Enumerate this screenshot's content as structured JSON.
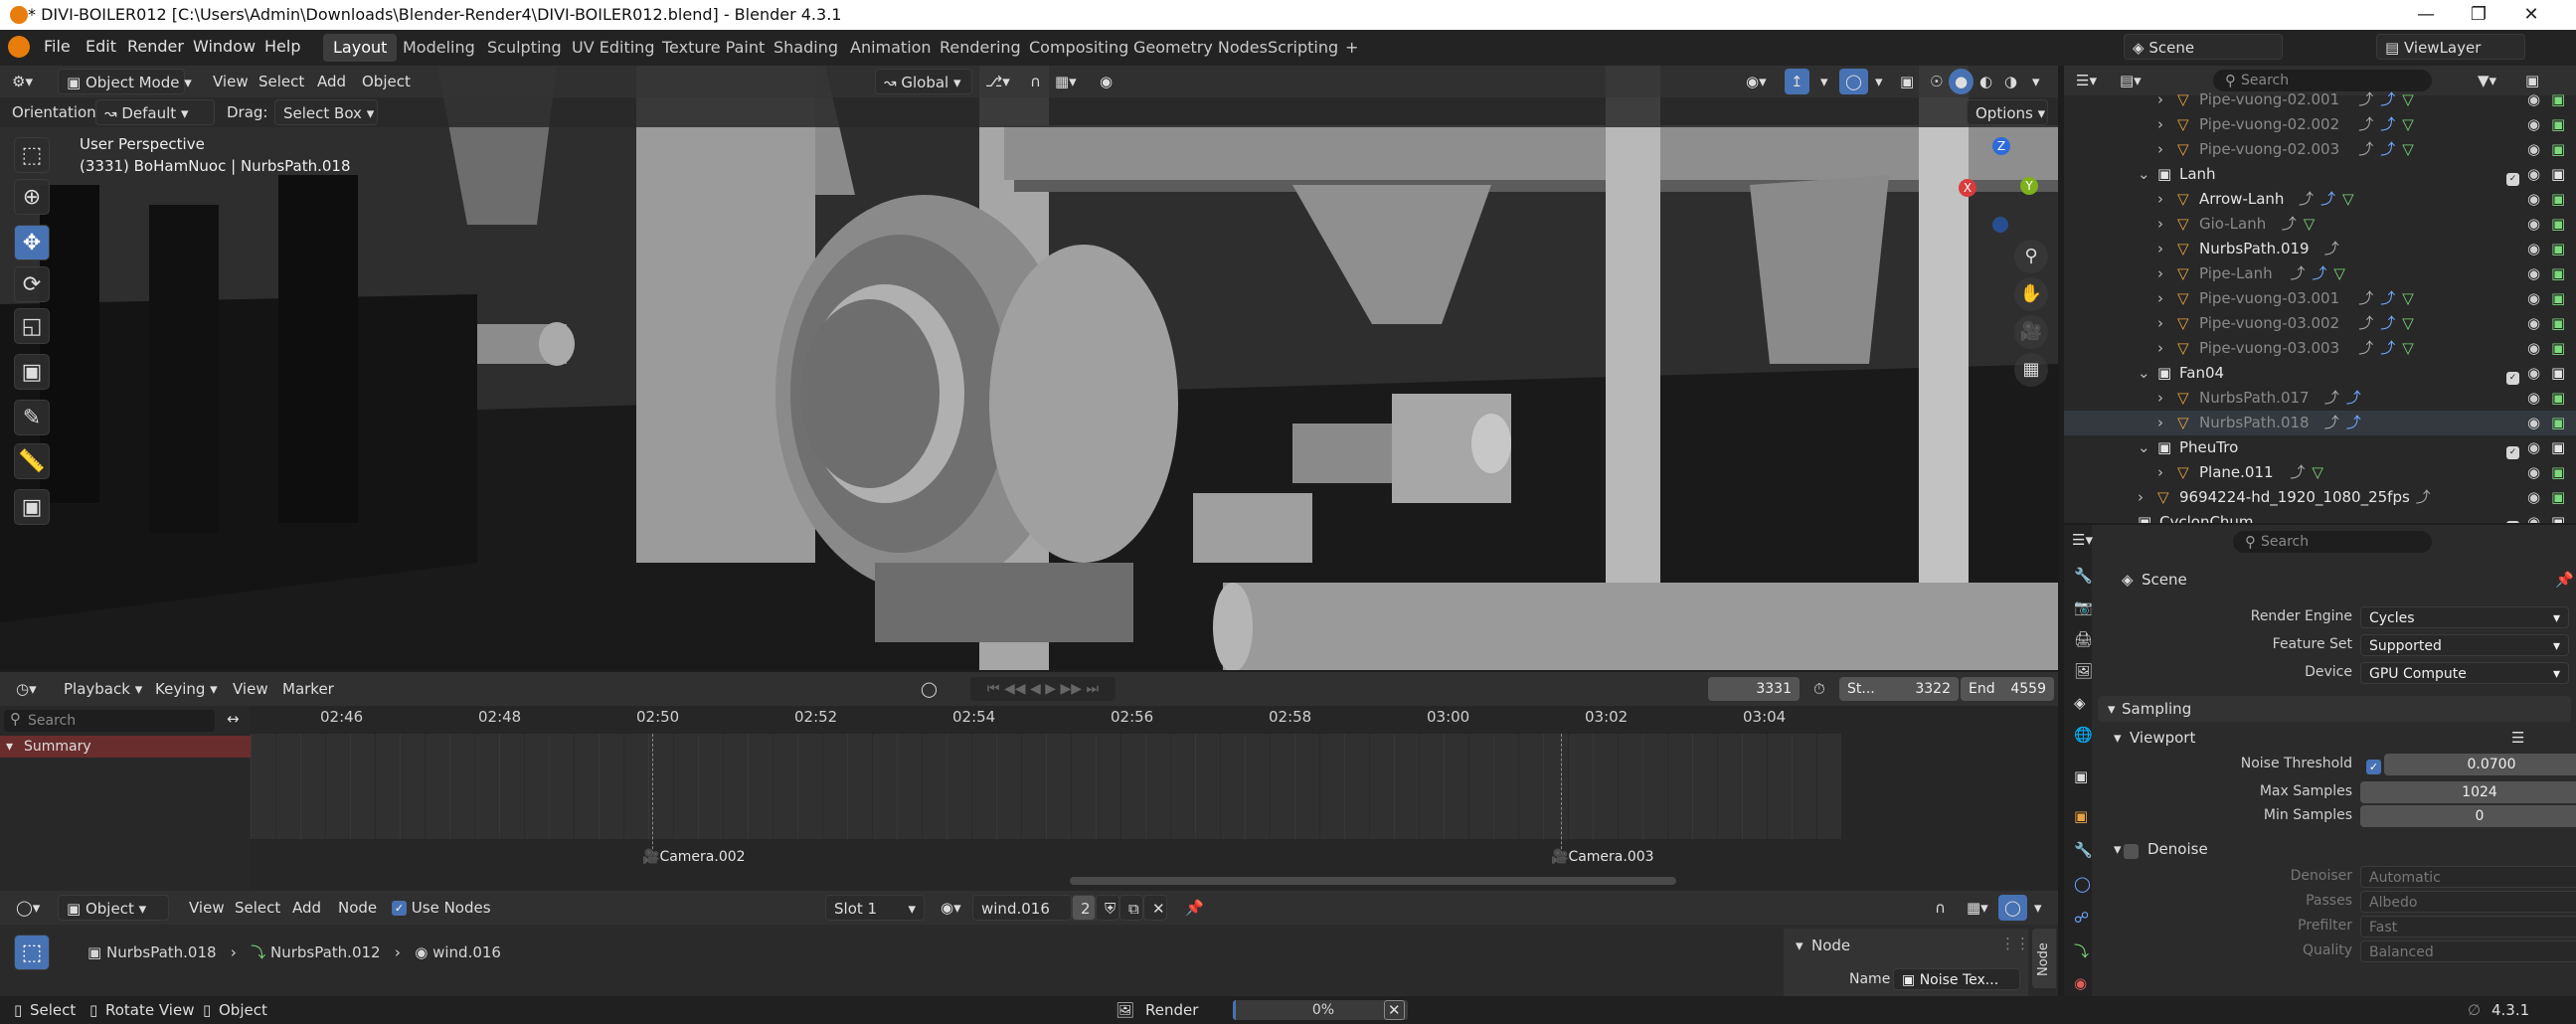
{
  "window": {
    "title": "* DIVI-BOILER012 [C:\\Users\\Admin\\Downloads\\Blender-Render4\\DIVI-BOILER012.blend] - Blender 4.3.1",
    "minimize": "—",
    "maximize": "❐",
    "close": "✕"
  },
  "menubar": {
    "items": [
      "File",
      "Edit",
      "Render",
      "Window",
      "Help"
    ],
    "workspaces": [
      "Layout",
      "Modeling",
      "Sculpting",
      "UV Editing",
      "Texture Paint",
      "Shading",
      "Animation",
      "Rendering",
      "Compositing",
      "Geometry Nodes",
      "Scripting"
    ],
    "active_workspace": "Layout",
    "add_workspace": "+",
    "scene_label": "Scene",
    "viewlayer_label": "ViewLayer"
  },
  "viewport": {
    "mode": "Object Mode",
    "menus": [
      "View",
      "Select",
      "Add",
      "Object"
    ],
    "orientation_label": "Orientation:",
    "orientation_value": "Default",
    "drag_label": "Drag:",
    "drag_value": "Select Box",
    "transform_orientation": "Global",
    "options_label": "Options",
    "perspective": "User Perspective",
    "object_info": "(3331) BoHamNuoc | NurbsPath.018",
    "gizmo": {
      "x": "X",
      "y": "Y",
      "z": "Z"
    }
  },
  "outliner": {
    "search_placeholder": "Search",
    "rows": [
      {
        "label": "Pipe-vuong-02.001",
        "indent": 4,
        "dim": true,
        "icons": [
          "⤴",
          "⤴",
          "▽"
        ]
      },
      {
        "label": "Pipe-vuong-02.002",
        "indent": 4,
        "dim": true,
        "icons": [
          "⤴",
          "⤴",
          "▽"
        ]
      },
      {
        "label": "Pipe-vuong-02.003",
        "indent": 4,
        "dim": true,
        "icons": [
          "⤴",
          "⤴",
          "▽"
        ]
      },
      {
        "label": "Lanh",
        "indent": 3,
        "dim": false,
        "collection": true
      },
      {
        "label": "Arrow-Lanh",
        "indent": 4,
        "dim": false,
        "icons": [
          "⤴",
          "⤴",
          "▽"
        ]
      },
      {
        "label": "Gio-Lanh",
        "indent": 4,
        "dim": true,
        "icons": [
          "⤴",
          "▽"
        ]
      },
      {
        "label": "NurbsPath.019",
        "indent": 4,
        "dim": false,
        "icons": [
          "⤴"
        ]
      },
      {
        "label": "Pipe-Lanh",
        "indent": 4,
        "dim": true,
        "icons": [
          "⤴",
          "⤴",
          "▽"
        ]
      },
      {
        "label": "Pipe-vuong-03.001",
        "indent": 4,
        "dim": true,
        "icons": [
          "⤴",
          "⤴",
          "▽"
        ]
      },
      {
        "label": "Pipe-vuong-03.002",
        "indent": 4,
        "dim": true,
        "icons": [
          "⤴",
          "⤴",
          "▽"
        ]
      },
      {
        "label": "Pipe-vuong-03.003",
        "indent": 4,
        "dim": true,
        "icons": [
          "⤴",
          "⤴",
          "▽"
        ]
      },
      {
        "label": "Fan04",
        "indent": 3,
        "dim": false,
        "collection": true
      },
      {
        "label": "NurbsPath.017",
        "indent": 4,
        "dim": true,
        "icons": [
          "⤴",
          "⤴"
        ]
      },
      {
        "label": "NurbsPath.018",
        "indent": 4,
        "dim": true,
        "icons": [
          "⤴",
          "⤴"
        ],
        "selected": true
      },
      {
        "label": "PheuTro",
        "indent": 3,
        "dim": false,
        "collection": true
      },
      {
        "label": "Plane.011",
        "indent": 4,
        "dim": false,
        "icons": [
          "⤴",
          "▽"
        ]
      },
      {
        "label": "9694224-hd_1920_1080_25fps",
        "indent": 3,
        "dim": false,
        "icons": [
          "⤴"
        ]
      },
      {
        "label": "CyclonChum",
        "indent": 2,
        "dim": false,
        "collection": true
      }
    ]
  },
  "properties": {
    "search_placeholder": "Search",
    "context": "Scene",
    "render_engine_label": "Render Engine",
    "render_engine": "Cycles",
    "feature_set_label": "Feature Set",
    "feature_set": "Supported",
    "device_label": "Device",
    "device": "GPU Compute",
    "sampling_label": "Sampling",
    "viewport_label": "Viewport",
    "noise_threshold_label": "Noise Threshold",
    "noise_threshold": "0.0700",
    "max_samples_label": "Max Samples",
    "max_samples": "1024",
    "min_samples_label": "Min Samples",
    "min_samples": "0",
    "denoise_label": "Denoise",
    "denoiser_label": "Denoiser",
    "denoiser": "Automatic",
    "passes_label": "Passes",
    "passes": "Albedo",
    "prefilter_label": "Prefilter",
    "prefilter": "Fast",
    "quality_label": "Quality",
    "quality": "Balanced"
  },
  "timeline": {
    "menus": [
      "Playback",
      "Keying",
      "View",
      "Marker"
    ],
    "current_frame": "3331",
    "start_label": "St...",
    "start": "3322",
    "end_label": "End",
    "end": "4559",
    "search_placeholder": "Search",
    "summary_label": "Summary",
    "ticks": [
      "02:46",
      "02:48",
      "02:50",
      "02:52",
      "02:54",
      "02:56",
      "02:58",
      "03:00",
      "03:02",
      "03:04"
    ],
    "markers": [
      "Camera.002",
      "Camera.003"
    ]
  },
  "node_editor": {
    "type": "Object",
    "menus": [
      "View",
      "Select",
      "Add",
      "Node"
    ],
    "use_nodes_label": "Use Nodes",
    "slot": "Slot 1",
    "material": "wind.016",
    "users": "2",
    "breadcrumb": [
      "NurbsPath.018",
      "NurbsPath.012",
      "wind.016"
    ],
    "panel_title": "Node",
    "name_label": "Name",
    "name_value": "Noise Tex...",
    "tab_label": "Node"
  },
  "statusbar": {
    "select": "Select",
    "rotate_view": "Rotate View",
    "object": "Object",
    "render_label": "Render",
    "render_progress": "0%",
    "version": "4.3.1"
  }
}
